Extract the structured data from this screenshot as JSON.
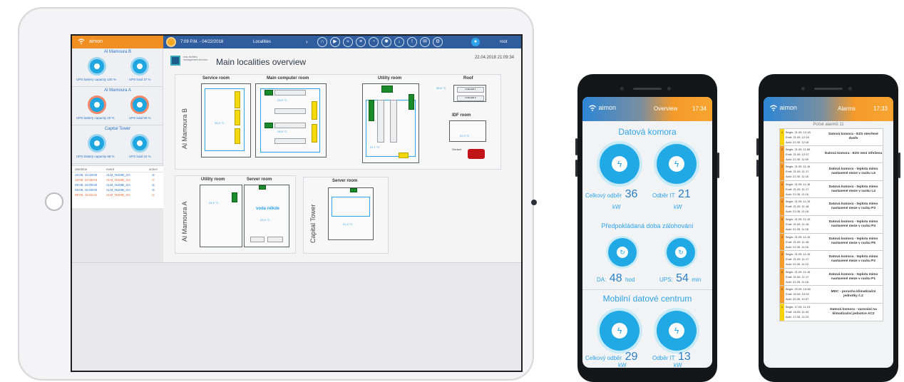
{
  "tablet": {
    "brand": "aimon",
    "datetime": "7:09 P.M. - 04/22/2018",
    "localities_label": "Localities",
    "user": "root",
    "sites": [
      {
        "name": "Al Mamoura B",
        "cap1": "UPS battery capacity 100 %",
        "cap2": "UPS load 27 %"
      },
      {
        "name": "Al Mamoura A",
        "cap1": "UPS battery capacity 20 %",
        "cap2": "UPS load 55 %"
      },
      {
        "name": "Capital Tower",
        "cap1": "UPS battery capacity 88 %",
        "cap2": "UPS load 42 %"
      }
    ],
    "events_header": {
      "col1": "datetime",
      "col2": "event",
      "col3": "action"
    },
    "events": [
      {
        "time": "18:08, 10:49:00",
        "event": "ALM_NUMB_OA",
        "kind": "info"
      },
      {
        "time": "18:08, 10:38:53",
        "event": "ALM_NUMB_OA",
        "kind": "alarm"
      },
      {
        "time": "09:08, 15:09:00",
        "event": "ALM_NUMB_OA",
        "kind": "info"
      },
      {
        "time": "09:08, 15:09:00",
        "event": "ALM_NUMB_OA",
        "kind": "info"
      },
      {
        "time": "09:08, 15:03:31",
        "event": "ALM_NUMB_OA",
        "kind": "alarm"
      }
    ],
    "logo_text": "mdc facilities management services",
    "main_title": "Main localities overview",
    "timestamp": "22.04.2018 21:09:34",
    "floor_labels": {
      "mamoura_b": "Al Mamoura B",
      "mamoura_a": "Al Mamoura A",
      "capital": "Capital Tower"
    },
    "rooms": {
      "service": "Service room",
      "main_computer": "Main computer room",
      "utility_b": "Utility room",
      "roof": "Roof",
      "idf": "IDF room",
      "utility_a": "Utility room",
      "server_a": "Server room",
      "server_c": "Server room"
    },
    "temps": {
      "mc": "23.6 °C",
      "mc2": "25.8 °C",
      "svc": "26.4 °C",
      "util": "21.7 °C",
      "idf": "22.3 °C",
      "roof": "25.6 °C",
      "sa": "22.6 °C",
      "sc": "21.4 °C",
      "ua": "24.5 °C"
    },
    "water_alert": "voda někde",
    "genset_label": "Genset",
    "chillers": [
      "CHILLER 1",
      "CHILLER 2"
    ]
  },
  "phone_overview": {
    "brand": "aimon",
    "title": "Overview",
    "clock": "17:34",
    "section1": "Datová komora",
    "s1_total_label": "Celkový odběr",
    "s1_total_value": "36",
    "s1_it_label": "Odběr IT",
    "s1_it_value": "21",
    "unit_kw": "kW",
    "section2": "Předpokládaná doba zálohování",
    "da_label": "DA:",
    "da_value": "48",
    "da_unit": "hod",
    "ups_label": "UPS:",
    "ups_value": "54",
    "ups_unit": "min",
    "section3": "Mobilní datové centrum",
    "s3_total_label": "Celkový odběr",
    "s3_total_value": "29",
    "s3_it_label": "Odběr IT",
    "s3_it_value": "13"
  },
  "phone_alarms": {
    "brand": "aimon",
    "title": "Alarms",
    "clock": "17:33",
    "count_text": "Počet alarmů 11",
    "alarms": [
      {
        "sev": "1",
        "begin": "Begin: 21.05. 12:18",
        "end": "Endt: 21.05. 12:18",
        "ack": "Ackt: 21.05. 12:18",
        "msg": "Datová komora - EZS otevřené dveře"
      },
      {
        "sev": "2",
        "begin": "Begin: 21.05. 11:56",
        "end": "Endt: 21.05. 12:37",
        "ack": "Ackt: 21.05. 11:59",
        "msg": "Datová komora - EZS není střežena"
      },
      {
        "sev": "2",
        "begin": "Begin: 21.05. 11:16",
        "end": "Endt: 21.05. 11:17",
        "ack": "Ackt: 21.05. 11:16",
        "msg": "Datová komora - teplota mimo nastavené meze v racku L5"
      },
      {
        "sev": "2",
        "begin": "Begin: 21.05. 11:16",
        "end": "Endt: 21.05. 11:17",
        "ack": "Ackt: 21.05. 11:16",
        "msg": "Datová komora - teplota mimo nastavené meze v racku L4"
      },
      {
        "sev": "2",
        "begin": "Begin: 21.05. 11:15",
        "end": "Endt: 21.05. 11:18",
        "ack": "Ackt: 21.05. 11:18",
        "msg": "Datová komora - teplota mimo nastavené meze v racku P3"
      },
      {
        "sev": "2",
        "begin": "Begin: 21.05. 11:15",
        "end": "Endt: 21.05. 11:16",
        "ack": "Ackt: 21.05. 11:16",
        "msg": "Datová komora - teplota mimo nastavené meze v racku P4"
      },
      {
        "sev": "2",
        "begin": "Begin: 21.05. 11:15",
        "end": "Endt: 21.05. 11:18",
        "ack": "Ackt: 21.05. 11:16",
        "msg": "Datová komora - teplota mimo nastavené meze v racku P5"
      },
      {
        "sev": "2",
        "begin": "Begin: 21.05. 11:15",
        "end": "Endt: 21.05. 11:17",
        "ack": "Ackt: 21.05. 11:10",
        "msg": "Datová komora - teplota mimo nastavené meze v racku P2"
      },
      {
        "sev": "2",
        "begin": "Begin: 21.05. 11:15",
        "end": "Endt: 21.05. 11:17",
        "ack": "Ackt: 21.05. 11:18",
        "msg": "Datová komora - teplota mimo nastavené meze v racku P1"
      },
      {
        "sev": "2",
        "begin": "Begin: 20.05. 10:38",
        "end": "Endt: 20.05. 10:32",
        "ack": "Ackt: 20.05. 10:37",
        "msg": "MDC - porucha klimatizační jednotky č.2"
      },
      {
        "sev": "1",
        "begin": "Begin: 17.05. 11:23",
        "end": "Endt: 18.05. 11:44",
        "ack": "Ackt: 17.05. 11:23",
        "msg": "Datová komora - varování na klimatizační jednotce AC2"
      }
    ]
  },
  "colors": {
    "accent": "#2ea3e8",
    "brand_orange": "#f18e22",
    "topbar": "#2f5d9e",
    "rack_green": "#1a8a2a",
    "rack_yellow": "#f5d90f"
  }
}
